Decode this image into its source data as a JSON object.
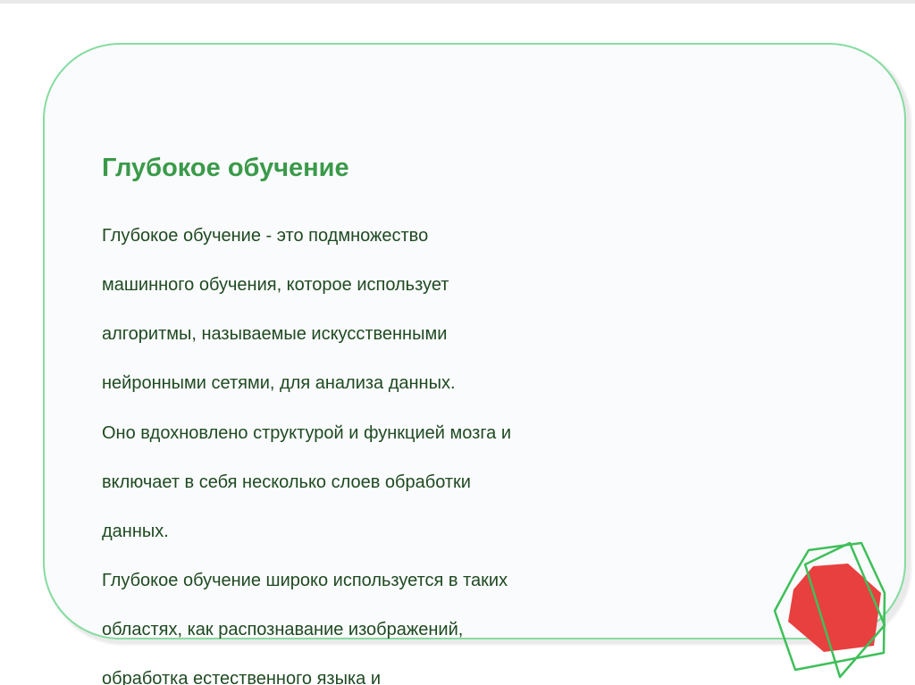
{
  "slide": {
    "title": "Глубокое обучение",
    "lines": [
      "Глубокое обучение - это подмножество",
      "машинного обучения, которое использует",
      "алгоритмы, называемые искусственными",
      "нейронными сетями, для анализа данных.",
      "Оно вдохновлено структурой и функцией мозга и",
      "включает в себя несколько слоев обработки",
      "данных.",
      "Глубокое обучение широко используется в таких",
      "областях, как распознавание изображений,",
      "обработка естественного языка и"
    ]
  },
  "colors": {
    "title": "#3a9a4a",
    "body_text": "#1f4a22",
    "card_border": "#86dca0",
    "card_fill": "#fafbfc",
    "decoration_fill": "#e8403f",
    "decoration_outline": "#3fbf5a"
  },
  "icons": {
    "decoration": "red-heptagon-shape"
  }
}
